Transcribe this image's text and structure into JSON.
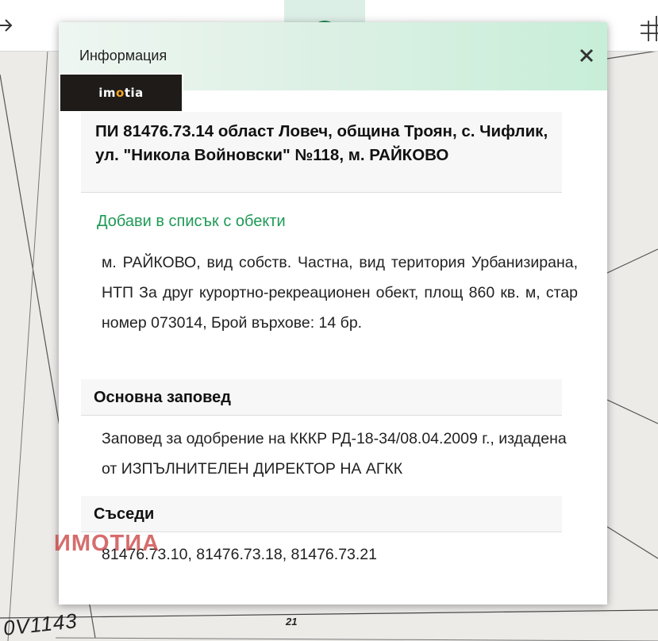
{
  "map": {
    "label_a": "0V1143",
    "label_b": "21"
  },
  "toolbar": {
    "tools": [
      {
        "name": "arrow-icon"
      },
      {
        "name": "location-pin-icon"
      },
      {
        "name": "square-icon"
      },
      {
        "name": "square-icon"
      },
      {
        "name": "info-icon",
        "active": true
      },
      {
        "name": "chart-icon"
      },
      {
        "name": "route-icon"
      },
      {
        "name": "map-icon"
      },
      {
        "name": "grid-icon"
      }
    ]
  },
  "dialog": {
    "title": "Информация",
    "close": "✕",
    "logo": {
      "pre": "im",
      "o": "o",
      "post": "tia"
    },
    "parcel_title": "ПИ 81476.73.14 област Ловеч, община Троян, с. Чифлик, ул. \"Никола Войновски\" №118, м. РАЙКОВО",
    "add_link": "Добави в списък с обекти",
    "description": "м. РАЙКОВО, вид собств. Частна, вид територия Урбанизирана, НТП За друг курортно-рекреационен обект, площ 860 кв. м, стар номер 073014, Брой върхове: 14 бр.",
    "order_heading": "Основна заповед",
    "order_text": "Заповед за одобрение на КККР РД-18-34/08.04.2009 г., издадена от ИЗПЪЛНИТЕЛЕН ДИРЕКТОР НА АГКК",
    "neighbors_heading": "Съседи",
    "neighbors_text": "81476.73.10, 81476.73.18, 81476.73.21",
    "watermark": "ИМОТИА"
  },
  "colors": {
    "accent_green": "#1f9a57",
    "active_tool_bg": "#dcefe7",
    "logo_accent": "#f5a623"
  }
}
